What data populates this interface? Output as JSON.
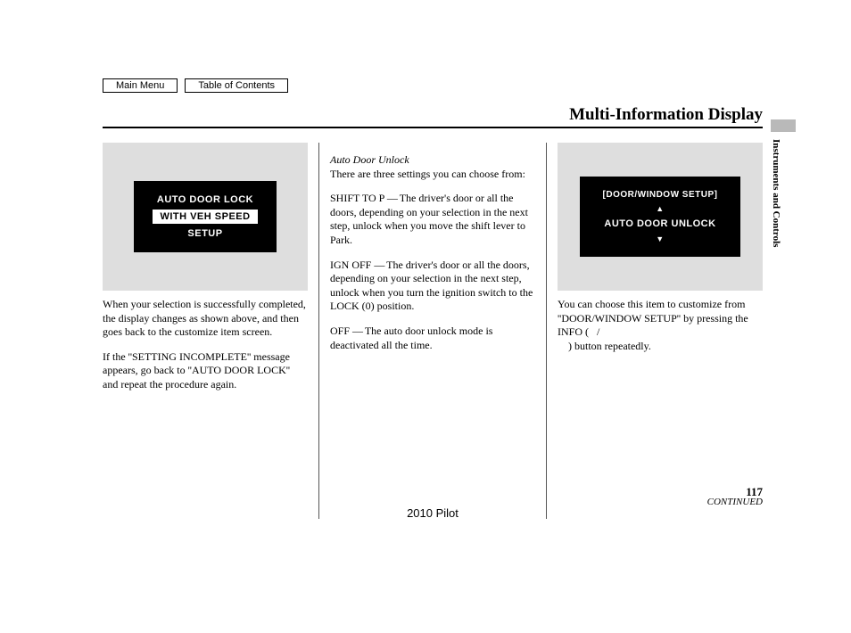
{
  "nav": {
    "main_menu": "Main Menu",
    "toc": "Table of Contents"
  },
  "title": "Multi-Information Display",
  "side_label": "Instruments and Controls",
  "screen1": {
    "line1": "AUTO DOOR LOCK",
    "line2": "WITH VEH SPEED",
    "line3": "SETUP"
  },
  "screen2": {
    "top": "[DOOR/WINDOW SETUP]",
    "mid": "AUTO DOOR UNLOCK"
  },
  "col1": {
    "p1": "When your selection is successfully completed, the display changes as shown above, and then goes back to the customize item screen.",
    "p2": "If the ''SETTING INCOMPLETE'' message appears, go back to ''AUTO DOOR LOCK'' and repeat the procedure again."
  },
  "col2": {
    "subhead": "Auto Door Unlock",
    "p1": "There are three settings you can choose from:",
    "p2a": "SHIFT TO P",
    "p2b": "The driver's door or all the doors, depending on your selection in the next step, unlock when you move the shift lever to Park.",
    "p3a": "IGN OFF",
    "p3b": "The driver's door or all the doors, depending on your selection in the next step, unlock when you turn the ignition switch to the LOCK (0) position.",
    "p4a": "OFF",
    "p4b": "The auto door unlock mode is deactivated all the time."
  },
  "col3": {
    "p1a": "You can choose this item to customize from ''DOOR/WINDOW SETUP'' by pressing the INFO (",
    "p1b": "/",
    "p1c": ") button repeatedly.",
    "continued": "CONTINUED"
  },
  "page_number": "117",
  "footer_model": "2010 Pilot"
}
